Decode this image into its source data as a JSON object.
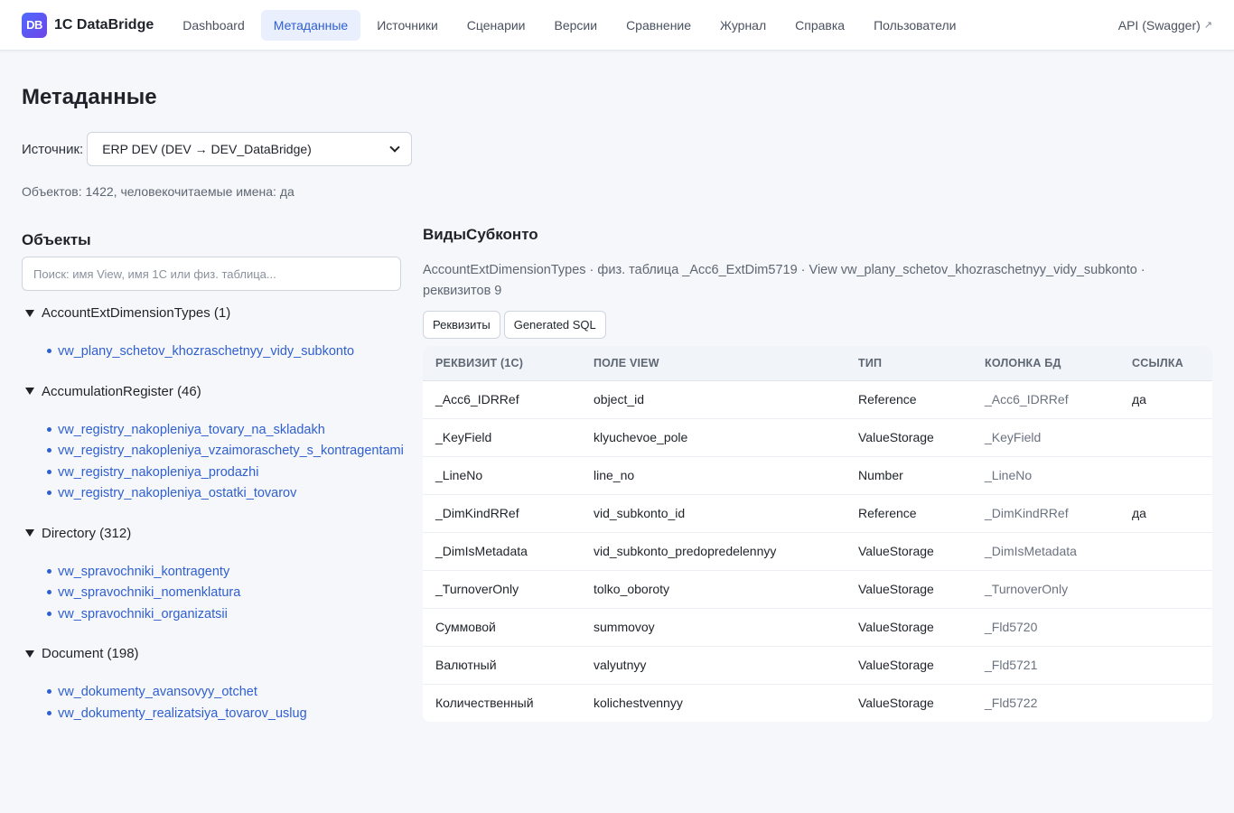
{
  "app": {
    "logo_text": "DB",
    "name": "1C DataBridge"
  },
  "nav": {
    "items": [
      {
        "label": "Dashboard"
      },
      {
        "label": "Метаданные"
      },
      {
        "label": "Источники"
      },
      {
        "label": "Сценарии"
      },
      {
        "label": "Версии"
      },
      {
        "label": "Сравнение"
      },
      {
        "label": "Журнал"
      },
      {
        "label": "Справка"
      },
      {
        "label": "Пользователи"
      }
    ],
    "active_index": 1,
    "api_link": "API (Swagger)",
    "api_icon": "↗"
  },
  "page": {
    "title": "Метаданные",
    "source_label": "Источник:",
    "source_value": "ERP DEV (DEV → DEV_DataBridge)",
    "stats": "Объектов: 1422, человекочитаемые имена: да"
  },
  "objects": {
    "title": "Объекты",
    "search_placeholder": "Поиск: имя View, имя 1С или физ. таблица...",
    "groups": [
      {
        "label": "AccountExtDimensionTypes (1)",
        "items": [
          "vw_plany_schetov_khozraschetnyy_vidy_subkonto"
        ]
      },
      {
        "label": "AccumulationRegister (46)",
        "items": [
          "vw_registry_nakopleniya_tovary_na_skladakh",
          "vw_registry_nakopleniya_vzaimoraschety_s_kontragentami",
          "vw_registry_nakopleniya_prodazhi",
          "vw_registry_nakopleniya_ostatki_tovarov"
        ]
      },
      {
        "label": "Directory (312)",
        "items": [
          "vw_spravochniki_kontragenty",
          "vw_spravochniki_nomenklatura",
          "vw_spravochniki_organizatsii"
        ]
      },
      {
        "label": "Document (198)",
        "items": [
          "vw_dokumenty_avansovyy_otchet",
          "vw_dokumenty_realizatsiya_tovarov_uslug"
        ]
      }
    ]
  },
  "detail": {
    "title": "ВидыСубконто",
    "meta": "AccountExtDimensionTypes · физ. таблица _Acc6_ExtDim5719 · View vw_plany_schetov_khozraschetnyy_vidy_subkonto · реквизитов 9",
    "tabs": [
      "Реквизиты",
      "Generated SQL"
    ],
    "columns": [
      "Реквизит (1С)",
      "Поле View",
      "Тип",
      "Колонка БД",
      "Ссылка"
    ],
    "rows": [
      [
        "_Acc6_IDRRef",
        "object_id",
        "Reference",
        "_Acc6_IDRRef",
        "да"
      ],
      [
        "_KeyField",
        "klyuchevoe_pole",
        "ValueStorage",
        "_KeyField",
        ""
      ],
      [
        "_LineNo",
        "line_no",
        "Number",
        "_LineNo",
        ""
      ],
      [
        "_DimKindRRef",
        "vid_subkonto_id",
        "Reference",
        "_DimKindRRef",
        "да"
      ],
      [
        "_DimIsMetadata",
        "vid_subkonto_predopredelennyy",
        "ValueStorage",
        "_DimIsMetadata",
        ""
      ],
      [
        "_TurnoverOnly",
        "tolko_oboroty",
        "ValueStorage",
        "_TurnoverOnly",
        ""
      ],
      [
        "Суммовой",
        "summovoy",
        "ValueStorage",
        "_Fld5720",
        ""
      ],
      [
        "Валютный",
        "valyutnyy",
        "ValueStorage",
        "_Fld5721",
        ""
      ],
      [
        "Количественный",
        "kolichestvennyy",
        "ValueStorage",
        "_Fld5722",
        ""
      ]
    ]
  },
  "colors": {
    "accent": "#2f5fd0",
    "active_nav_bg": "#e9effd",
    "logo_gradient_start": "#4f6bff",
    "logo_gradient_end": "#6e43e6"
  }
}
